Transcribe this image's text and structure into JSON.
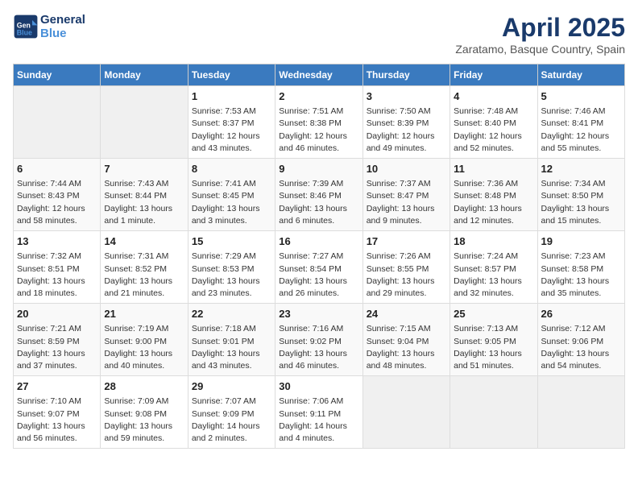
{
  "header": {
    "logo_line1": "General",
    "logo_line2": "Blue",
    "month_title": "April 2025",
    "location": "Zaratamo, Basque Country, Spain"
  },
  "weekdays": [
    "Sunday",
    "Monday",
    "Tuesday",
    "Wednesday",
    "Thursday",
    "Friday",
    "Saturday"
  ],
  "weeks": [
    [
      {
        "day": "",
        "info": ""
      },
      {
        "day": "",
        "info": ""
      },
      {
        "day": "1",
        "info": "Sunrise: 7:53 AM\nSunset: 8:37 PM\nDaylight: 12 hours and 43 minutes."
      },
      {
        "day": "2",
        "info": "Sunrise: 7:51 AM\nSunset: 8:38 PM\nDaylight: 12 hours and 46 minutes."
      },
      {
        "day": "3",
        "info": "Sunrise: 7:50 AM\nSunset: 8:39 PM\nDaylight: 12 hours and 49 minutes."
      },
      {
        "day": "4",
        "info": "Sunrise: 7:48 AM\nSunset: 8:40 PM\nDaylight: 12 hours and 52 minutes."
      },
      {
        "day": "5",
        "info": "Sunrise: 7:46 AM\nSunset: 8:41 PM\nDaylight: 12 hours and 55 minutes."
      }
    ],
    [
      {
        "day": "6",
        "info": "Sunrise: 7:44 AM\nSunset: 8:43 PM\nDaylight: 12 hours and 58 minutes."
      },
      {
        "day": "7",
        "info": "Sunrise: 7:43 AM\nSunset: 8:44 PM\nDaylight: 13 hours and 1 minute."
      },
      {
        "day": "8",
        "info": "Sunrise: 7:41 AM\nSunset: 8:45 PM\nDaylight: 13 hours and 3 minutes."
      },
      {
        "day": "9",
        "info": "Sunrise: 7:39 AM\nSunset: 8:46 PM\nDaylight: 13 hours and 6 minutes."
      },
      {
        "day": "10",
        "info": "Sunrise: 7:37 AM\nSunset: 8:47 PM\nDaylight: 13 hours and 9 minutes."
      },
      {
        "day": "11",
        "info": "Sunrise: 7:36 AM\nSunset: 8:48 PM\nDaylight: 13 hours and 12 minutes."
      },
      {
        "day": "12",
        "info": "Sunrise: 7:34 AM\nSunset: 8:50 PM\nDaylight: 13 hours and 15 minutes."
      }
    ],
    [
      {
        "day": "13",
        "info": "Sunrise: 7:32 AM\nSunset: 8:51 PM\nDaylight: 13 hours and 18 minutes."
      },
      {
        "day": "14",
        "info": "Sunrise: 7:31 AM\nSunset: 8:52 PM\nDaylight: 13 hours and 21 minutes."
      },
      {
        "day": "15",
        "info": "Sunrise: 7:29 AM\nSunset: 8:53 PM\nDaylight: 13 hours and 23 minutes."
      },
      {
        "day": "16",
        "info": "Sunrise: 7:27 AM\nSunset: 8:54 PM\nDaylight: 13 hours and 26 minutes."
      },
      {
        "day": "17",
        "info": "Sunrise: 7:26 AM\nSunset: 8:55 PM\nDaylight: 13 hours and 29 minutes."
      },
      {
        "day": "18",
        "info": "Sunrise: 7:24 AM\nSunset: 8:57 PM\nDaylight: 13 hours and 32 minutes."
      },
      {
        "day": "19",
        "info": "Sunrise: 7:23 AM\nSunset: 8:58 PM\nDaylight: 13 hours and 35 minutes."
      }
    ],
    [
      {
        "day": "20",
        "info": "Sunrise: 7:21 AM\nSunset: 8:59 PM\nDaylight: 13 hours and 37 minutes."
      },
      {
        "day": "21",
        "info": "Sunrise: 7:19 AM\nSunset: 9:00 PM\nDaylight: 13 hours and 40 minutes."
      },
      {
        "day": "22",
        "info": "Sunrise: 7:18 AM\nSunset: 9:01 PM\nDaylight: 13 hours and 43 minutes."
      },
      {
        "day": "23",
        "info": "Sunrise: 7:16 AM\nSunset: 9:02 PM\nDaylight: 13 hours and 46 minutes."
      },
      {
        "day": "24",
        "info": "Sunrise: 7:15 AM\nSunset: 9:04 PM\nDaylight: 13 hours and 48 minutes."
      },
      {
        "day": "25",
        "info": "Sunrise: 7:13 AM\nSunset: 9:05 PM\nDaylight: 13 hours and 51 minutes."
      },
      {
        "day": "26",
        "info": "Sunrise: 7:12 AM\nSunset: 9:06 PM\nDaylight: 13 hours and 54 minutes."
      }
    ],
    [
      {
        "day": "27",
        "info": "Sunrise: 7:10 AM\nSunset: 9:07 PM\nDaylight: 13 hours and 56 minutes."
      },
      {
        "day": "28",
        "info": "Sunrise: 7:09 AM\nSunset: 9:08 PM\nDaylight: 13 hours and 59 minutes."
      },
      {
        "day": "29",
        "info": "Sunrise: 7:07 AM\nSunset: 9:09 PM\nDaylight: 14 hours and 2 minutes."
      },
      {
        "day": "30",
        "info": "Sunrise: 7:06 AM\nSunset: 9:11 PM\nDaylight: 14 hours and 4 minutes."
      },
      {
        "day": "",
        "info": ""
      },
      {
        "day": "",
        "info": ""
      },
      {
        "day": "",
        "info": ""
      }
    ]
  ]
}
